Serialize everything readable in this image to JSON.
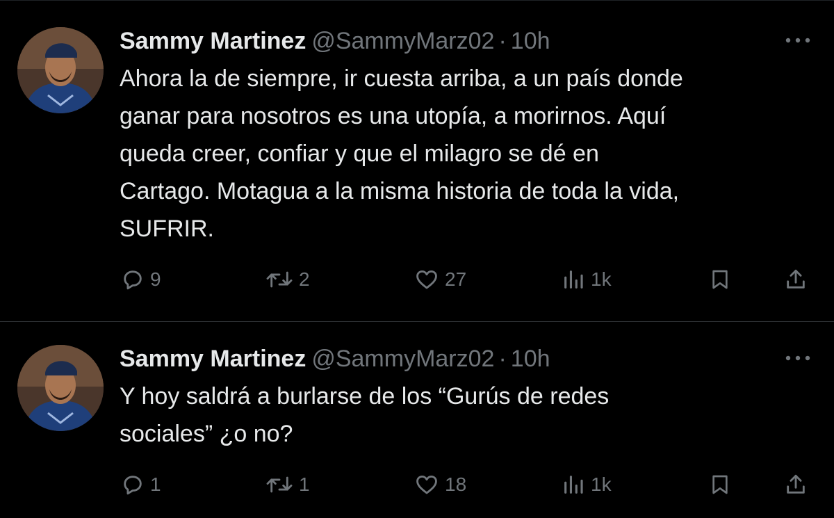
{
  "tweets": [
    {
      "display_name": "Sammy Martinez",
      "handle": "@SammyMarz02",
      "separator": "·",
      "time": "10h",
      "text": "Ahora la de siempre, ir cuesta arriba, a un país donde ganar para nosotros es una utopía, a morirnos. Aquí queda creer, confiar y que el milagro se dé en Cartago. Motagua a la misma historia de toda la vida, SUFRIR.",
      "lines": [
        "Ahora la de siempre, ir cuesta arriba, a un país donde",
        "ganar para nosotros es una utopía, a morirnos. Aquí",
        "queda creer, confiar y que el milagro se dé en",
        "Cartago. Motagua a la misma historia de toda la vida,",
        "SUFRIR."
      ],
      "replies": "9",
      "reposts": "2",
      "likes": "27",
      "views": "1k"
    },
    {
      "display_name": "Sammy Martinez",
      "handle": "@SammyMarz02",
      "separator": "·",
      "time": "10h",
      "text": "Y hoy saldrá a burlarse de los “Gurús de redes sociales” ¿o no?",
      "lines": [
        "Y hoy saldrá a burlarse de los “Gurús de redes",
        "sociales” ¿o no?"
      ],
      "replies": "1",
      "reposts": "1",
      "likes": "18",
      "views": "1k"
    }
  ],
  "icons": {
    "more": "more-dots-icon",
    "reply": "reply-bubble-icon",
    "repost": "repost-arrows-icon",
    "like": "heart-icon",
    "views": "views-bars-icon",
    "bookmark": "bookmark-icon",
    "share": "share-upload-icon"
  },
  "colors": {
    "background": "#000000",
    "text_primary": "#e7e9ea",
    "text_secondary": "#71767b",
    "divider": "#2f3336"
  }
}
